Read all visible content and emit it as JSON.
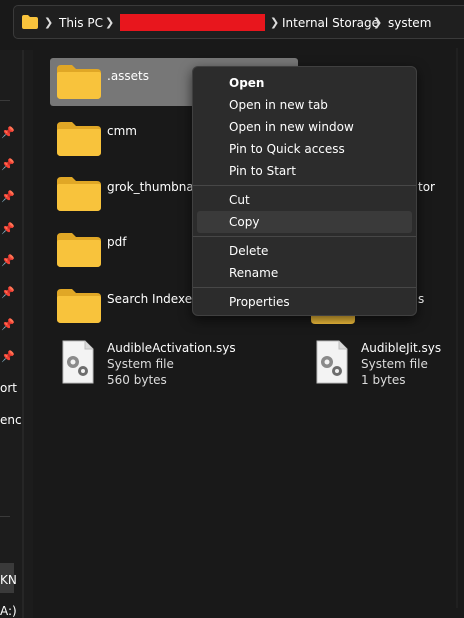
{
  "breadcrumb": {
    "root": "This PC",
    "segment3": "Internal Storage",
    "segment4": "system"
  },
  "nav": {
    "fragment_1": "ort",
    "fragment_2": "enc",
    "fragment_3": "KN",
    "fragment_4": "A:)"
  },
  "files": {
    "assets": ".assets",
    "cmm": "cmm",
    "grok": "grok_thumbnails",
    "pdf": "pdf",
    "search": "Search Indexes",
    "partial_right_1": "tor",
    "partial_right_2": "s",
    "audible_activation": {
      "name": "AudibleActivation.sys",
      "type": "System file",
      "size": "560 bytes"
    },
    "audible_jit": {
      "name": "AudibleJit.sys",
      "type": "System file",
      "size": "1 bytes"
    }
  },
  "context_menu": {
    "open": "Open",
    "open_new_tab": "Open in new tab",
    "open_new_window": "Open in new window",
    "pin_quick": "Pin to Quick access",
    "pin_start": "Pin to Start",
    "cut": "Cut",
    "copy": "Copy",
    "delete": "Delete",
    "rename": "Rename",
    "properties": "Properties"
  },
  "colors": {
    "folder": "#f8c33c",
    "redaction": "#e8161d",
    "selection": "#777777",
    "menu_bg": "#2c2c2c"
  }
}
